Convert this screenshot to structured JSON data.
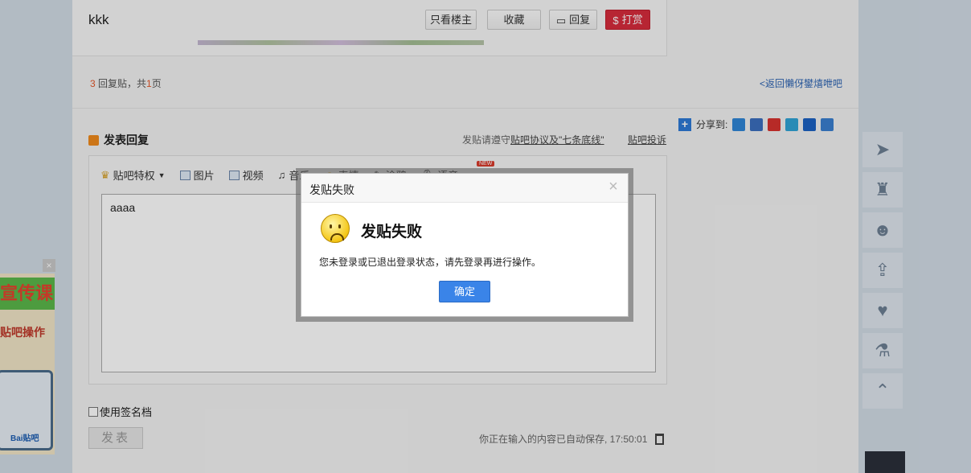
{
  "post": {
    "username": "kkk",
    "buttons": {
      "only_op": "只看楼主",
      "favorite": "收藏",
      "reply": "回复",
      "reward": "打赏"
    }
  },
  "pager": {
    "count": "3",
    "text_mid": "回复贴，共",
    "pages": "1",
    "text_end": "页",
    "back_link": "<返回懶伢鐢熺呭吧"
  },
  "share": {
    "label": "分享到:"
  },
  "reply": {
    "title": "发表回复",
    "rules_prefix": "发贴请遵守",
    "rules_link": "贴吧协议及\"七条底线\"",
    "report": "贴吧投诉"
  },
  "toolbar": {
    "privilege": "贴吧特权",
    "image": "图片",
    "video": "视频",
    "music": "音乐",
    "emoji": "表情",
    "graffiti": "涂鸦",
    "voice": "语音",
    "new_badge": "NEW"
  },
  "editor": {
    "content": "aaaa"
  },
  "signature": {
    "label": "使用签名档"
  },
  "submit": {
    "label": "发表"
  },
  "autosave": {
    "text": "你正在输入的内容已自动保存, 17:50:01"
  },
  "ad": {
    "top_text": "宣传课",
    "mid_text": "贴吧操作",
    "brand": "Bai贴吧"
  },
  "dialog": {
    "title": "发贴失败",
    "heading": "发贴失败",
    "message": "您未登录或已退出登录状态，请先登录再进行操作。",
    "ok": "确定",
    "close": "×"
  }
}
